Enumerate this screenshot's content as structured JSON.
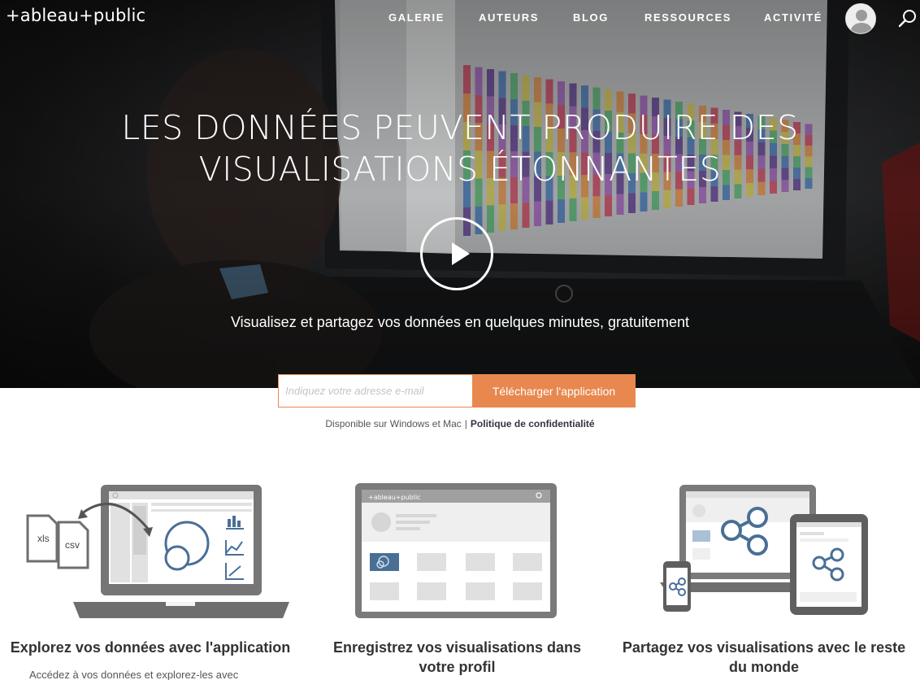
{
  "nav": {
    "logo": "+ableau+public",
    "items": [
      "GALERIE",
      "AUTEURS",
      "BLOG",
      "RESSOURCES",
      "ACTIVITÉ"
    ]
  },
  "hero": {
    "headline": "LES DONNÉES PEUVENT PRODUIRE DES VISUALISATIONS ÉTONNANTES",
    "subline_text": "Visualisez et partagez vos données en quelques minutes, ",
    "subline_bold": "gratuitement"
  },
  "signup": {
    "email_placeholder": "Indiquez votre adresse e-mail",
    "button_label": "Télécharger l'application",
    "availability": "Disponible sur Windows et Mac",
    "separator": "|",
    "privacy_link": "Politique de confidentialité"
  },
  "features": [
    {
      "title": "Explorez vos données avec l'application",
      "description": "Accédez à vos données et explorez-les avec",
      "file_labels": [
        "xls",
        "csv"
      ]
    },
    {
      "title": "Enregistrez vos visualisations dans votre profil",
      "screen_logo": "+ableau+public"
    },
    {
      "title": "Partagez vos visualisations avec le reste du monde"
    }
  ],
  "colors": {
    "accent": "#e8884f",
    "icon_blue": "#4a6f96",
    "device_gray": "#7a7a7a"
  },
  "icons": [
    "search-icon",
    "user-avatar-icon",
    "play-icon",
    "share-icon"
  ]
}
